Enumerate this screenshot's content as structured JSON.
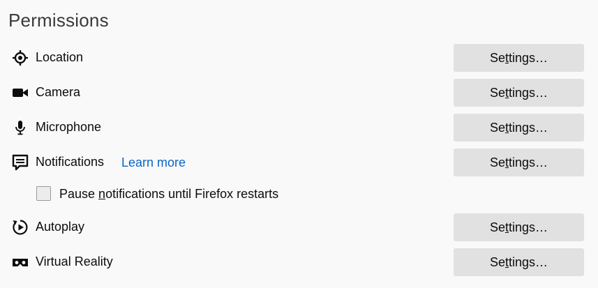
{
  "section": {
    "title": "Permissions"
  },
  "permissions": [
    {
      "label": "Location",
      "icon": "location-icon",
      "button_pre": "Se",
      "button_acc": "t",
      "button_post": "tings…"
    },
    {
      "label": "Camera",
      "icon": "camera-icon",
      "button_pre": "Se",
      "button_acc": "t",
      "button_post": "tings…"
    },
    {
      "label": "Microphone",
      "icon": "microphone-icon",
      "button_pre": "Se",
      "button_acc": "t",
      "button_post": "tings…"
    },
    {
      "label": "Notifications",
      "icon": "notification-icon",
      "link": "Learn more",
      "button_pre": "Se",
      "button_acc": "t",
      "button_post": "tings…"
    },
    {
      "label": "Autoplay",
      "icon": "autoplay-icon",
      "button_pre": "Se",
      "button_acc": "t",
      "button_post": "tings…"
    },
    {
      "label": "Virtual Reality",
      "icon": "vr-headset-icon",
      "button_pre": "Se",
      "button_acc": "t",
      "button_post": "tings…"
    }
  ],
  "pause_notifications": {
    "label_pre": "Pause ",
    "label_acc": "n",
    "label_post": "otifications until Firefox restarts",
    "checked": false
  }
}
